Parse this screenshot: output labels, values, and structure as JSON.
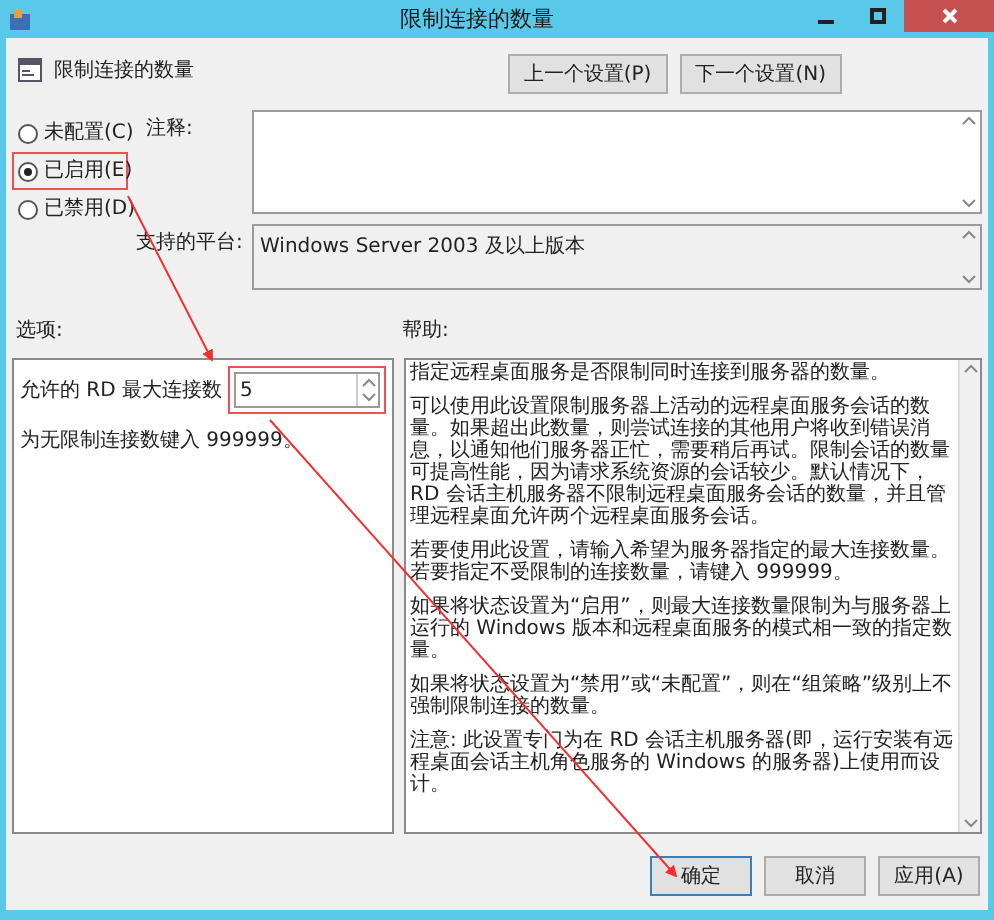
{
  "window": {
    "title": "限制连接的数量"
  },
  "header": {
    "title": "限制连接的数量"
  },
  "nav_buttons": [
    "上一个设置(P)",
    "下一个设置(N)"
  ],
  "state_options": [
    {
      "label": "未配置(C)",
      "selected": false
    },
    {
      "label": "已启用(E)",
      "selected": true
    },
    {
      "label": "已禁用(D)",
      "selected": false
    }
  ],
  "comment": {
    "label": "注释:"
  },
  "platform": {
    "label": "支持的平台:",
    "value": "Windows Server 2003 及以上版本"
  },
  "options": {
    "label": "选项:",
    "field_label": "允许的 RD 最大连接数",
    "value": "5",
    "hint": "为无限制连接数键入 999999。"
  },
  "help": {
    "label": "帮助:",
    "paragraphs": [
      "指定远程桌面服务是否限制同时连接到服务器的数量。",
      "可以使用此设置限制服务器上活动的远程桌面服务会话的数量。如果超出此数量，则尝试连接的其他用户将收到错误消息，以通知他们服务器正忙，需要稍后再试。限制会话的数量可提高性能，因为请求系统资源的会话较少。默认情况下，RD 会话主机服务器不限制远程桌面服务会话的数量，并且管理远程桌面允许两个远程桌面服务会话。",
      "若要使用此设置，请输入希望为服务器指定的最大连接数量。若要指定不受限制的连接数量，请键入 999999。",
      "如果将状态设置为“启用”，则最大连接数量限制为与服务器上运行的 Windows 版本和远程桌面服务的模式相一致的指定数量。",
      "如果将状态设置为“禁用”或“未配置”，则在“组策略”级别上不强制限制连接的数量。",
      "注意: 此设置专门为在 RD 会话主机服务器(即，运行安装有远程桌面会话主机角色服务的 Windows 的服务器)上使用而设计。"
    ]
  },
  "footer_buttons": [
    "确定",
    "取消",
    "应用(A)"
  ]
}
